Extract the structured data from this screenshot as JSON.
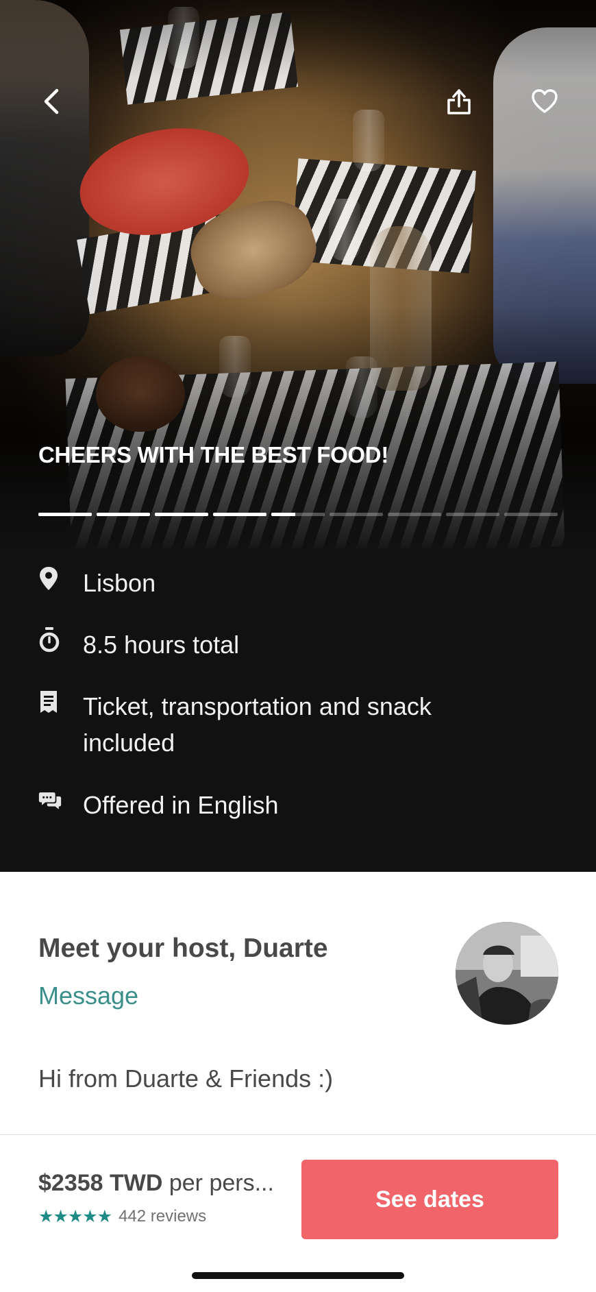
{
  "hero": {
    "title": "CHEERS WITH THE BEST FOOD!",
    "photo_count": 9,
    "current_photo": 5,
    "current_photo_progress": 0.45
  },
  "toolbar": {
    "back_icon": "chevron-left-icon",
    "share_icon": "share-icon",
    "save_icon": "heart-icon"
  },
  "details": [
    {
      "icon": "location-pin-icon",
      "text": "Lisbon"
    },
    {
      "icon": "timer-icon",
      "text": "8.5 hours total"
    },
    {
      "icon": "receipt-icon",
      "text": "Ticket, transportation and snack included"
    },
    {
      "icon": "chat-bubbles-icon",
      "text": "Offered in English"
    }
  ],
  "host": {
    "title": "Meet your host, Duarte",
    "message_label": "Message",
    "bio": "Hi from Duarte  & Friends :)"
  },
  "footer": {
    "price_amount": "$2358 TWD",
    "price_unit": "per pers...",
    "stars": "★★★★★",
    "rating": 5,
    "reviews": "442 reviews",
    "cta_label": "See dates"
  },
  "colors": {
    "accent": "#f0646a",
    "link": "#3a8f8a",
    "dark_bg": "#111111"
  }
}
